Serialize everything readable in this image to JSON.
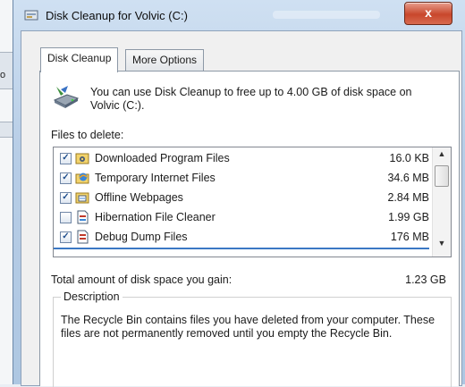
{
  "background": {
    "fragment_text": "o"
  },
  "window": {
    "title": "Disk Cleanup for Volvic (C:)",
    "close_label": "x"
  },
  "tabs": [
    {
      "label": "Disk Cleanup",
      "active": true
    },
    {
      "label": "More Options",
      "active": false
    }
  ],
  "info_text": "You can use Disk Cleanup to free up to 4.00 GB of disk space on Volvic (C:).",
  "files_label": "Files to delete:",
  "files": [
    {
      "name": "Downloaded Program Files",
      "size": "16.0 KB",
      "checked": true,
      "icon": "folder-gear-icon"
    },
    {
      "name": "Temporary Internet Files",
      "size": "34.6 MB",
      "checked": true,
      "icon": "internet-files-icon"
    },
    {
      "name": "Offline Webpages",
      "size": "2.84 MB",
      "checked": true,
      "icon": "offline-webpage-icon"
    },
    {
      "name": "Hibernation File Cleaner",
      "size": "1.99 GB",
      "checked": false,
      "icon": "hibernation-file-icon"
    },
    {
      "name": "Debug Dump Files",
      "size": "176 MB",
      "checked": true,
      "icon": "debug-dump-icon"
    }
  ],
  "total_label": "Total amount of disk space you gain:",
  "total_value": "1.23 GB",
  "description": {
    "legend": "Description",
    "text": "The Recycle Bin contains files you have deleted from your computer. These files are not permanently removed until you empty the Recycle Bin."
  }
}
